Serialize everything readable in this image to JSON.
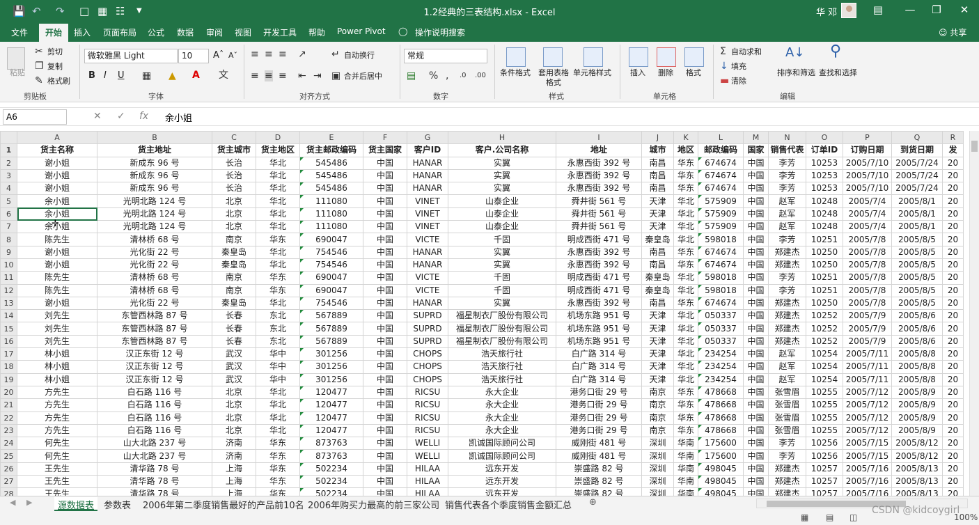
{
  "window": {
    "title": "1.2经典的三表结构.xlsx  -  Excel",
    "user": "华 邓",
    "save_icon": "save-icon",
    "undo_icon": "undo-icon",
    "redo_icon": "redo-icon"
  },
  "ribbon_tabs": [
    "文件",
    "开始",
    "插入",
    "页面布局",
    "公式",
    "数据",
    "审阅",
    "视图",
    "开发工具",
    "帮助",
    "Power Pivot",
    "操作说明搜索",
    "共享"
  ],
  "ribbon": {
    "clipboard": {
      "paste": "粘贴",
      "cut": "剪切",
      "copy": "复制",
      "format_painter": "格式刷",
      "group": "剪贴板"
    },
    "font": {
      "name": "微软雅黑 Light",
      "size": "10",
      "bold": "B",
      "italic": "I",
      "underline": "U",
      "group": "字体"
    },
    "alignment": {
      "wrap": "自动换行",
      "merge": "合并后居中",
      "group": "对齐方式"
    },
    "number": {
      "format": "常规",
      "group": "数字"
    },
    "styles": {
      "conditional": "条件格式",
      "table": "套用表格格式",
      "cell_styles": "单元格样式",
      "group": "样式"
    },
    "cells": {
      "insert": "插入",
      "delete": "删除",
      "format": "格式",
      "group": "单元格"
    },
    "editing": {
      "autosum": "自动求和",
      "fill": "填充",
      "clear": "清除",
      "sort": "排序和筛选",
      "find": "查找和选择",
      "group": "编辑"
    }
  },
  "formula_bar": {
    "name_box": "A6",
    "fx": "fx",
    "value": "余小姐"
  },
  "columns": [
    "A",
    "B",
    "C",
    "D",
    "E",
    "F",
    "G",
    "H",
    "I",
    "J",
    "K",
    "L",
    "M",
    "N",
    "O",
    "P",
    "Q",
    "R"
  ],
  "header_row": [
    "货主名称",
    "货主地址",
    "货主城市",
    "货主地区",
    "货主邮政编码",
    "货主国家",
    "客户ID",
    "客户.公司名称",
    "地址",
    "城市",
    "地区",
    "邮政编码",
    "国家",
    "销售代表",
    "订单ID",
    "订购日期",
    "到货日期",
    "发"
  ],
  "rows": [
    [
      "谢小姐",
      "新成东 96 号",
      "长治",
      "华北",
      "545486",
      "中国",
      "HANAR",
      "实翼",
      "永惠西街 392 号",
      "南昌",
      "华东",
      "674674",
      "中国",
      "李芳",
      "10253",
      "2005/7/10",
      "2005/7/24",
      "20"
    ],
    [
      "谢小姐",
      "新成东 96 号",
      "长治",
      "华北",
      "545486",
      "中国",
      "HANAR",
      "实翼",
      "永惠西街 392 号",
      "南昌",
      "华东",
      "674674",
      "中国",
      "李芳",
      "10253",
      "2005/7/10",
      "2005/7/24",
      "20"
    ],
    [
      "谢小姐",
      "新成东 96 号",
      "长治",
      "华北",
      "545486",
      "中国",
      "HANAR",
      "实翼",
      "永惠西街 392 号",
      "南昌",
      "华东",
      "674674",
      "中国",
      "李芳",
      "10253",
      "2005/7/10",
      "2005/7/24",
      "20"
    ],
    [
      "余小姐",
      "光明北路 124 号",
      "北京",
      "华北",
      "111080",
      "中国",
      "VINET",
      "山泰企业",
      "舜井街 561 号",
      "天津",
      "华北",
      "575909",
      "中国",
      "赵军",
      "10248",
      "2005/7/4",
      "2005/8/1",
      "20"
    ],
    [
      "余小姐",
      "光明北路 124 号",
      "北京",
      "华北",
      "111080",
      "中国",
      "VINET",
      "山泰企业",
      "舜井街 561 号",
      "天津",
      "华北",
      "575909",
      "中国",
      "赵军",
      "10248",
      "2005/7/4",
      "2005/8/1",
      "20"
    ],
    [
      "余小姐",
      "光明北路 124 号",
      "北京",
      "华北",
      "111080",
      "中国",
      "VINET",
      "山泰企业",
      "舜井街 561 号",
      "天津",
      "华北",
      "575909",
      "中国",
      "赵军",
      "10248",
      "2005/7/4",
      "2005/8/1",
      "20"
    ],
    [
      "陈先生",
      "清林桥 68 号",
      "南京",
      "华东",
      "690047",
      "中国",
      "VICTE",
      "千固",
      "明成西街 471 号",
      "秦皇岛",
      "华北",
      "598018",
      "中国",
      "李芳",
      "10251",
      "2005/7/8",
      "2005/8/5",
      "20"
    ],
    [
      "谢小姐",
      "光化街 22 号",
      "秦皇岛",
      "华北",
      "754546",
      "中国",
      "HANAR",
      "实翼",
      "永惠西街 392 号",
      "南昌",
      "华东",
      "674674",
      "中国",
      "郑建杰",
      "10250",
      "2005/7/8",
      "2005/8/5",
      "20"
    ],
    [
      "谢小姐",
      "光化街 22 号",
      "秦皇岛",
      "华北",
      "754546",
      "中国",
      "HANAR",
      "实翼",
      "永惠西街 392 号",
      "南昌",
      "华东",
      "674674",
      "中国",
      "郑建杰",
      "10250",
      "2005/7/8",
      "2005/8/5",
      "20"
    ],
    [
      "陈先生",
      "清林桥 68 号",
      "南京",
      "华东",
      "690047",
      "中国",
      "VICTE",
      "千固",
      "明成西街 471 号",
      "秦皇岛",
      "华北",
      "598018",
      "中国",
      "李芳",
      "10251",
      "2005/7/8",
      "2005/8/5",
      "20"
    ],
    [
      "陈先生",
      "清林桥 68 号",
      "南京",
      "华东",
      "690047",
      "中国",
      "VICTE",
      "千固",
      "明成西街 471 号",
      "秦皇岛",
      "华北",
      "598018",
      "中国",
      "李芳",
      "10251",
      "2005/7/8",
      "2005/8/5",
      "20"
    ],
    [
      "谢小姐",
      "光化街 22 号",
      "秦皇岛",
      "华北",
      "754546",
      "中国",
      "HANAR",
      "实翼",
      "永惠西街 392 号",
      "南昌",
      "华东",
      "674674",
      "中国",
      "郑建杰",
      "10250",
      "2005/7/8",
      "2005/8/5",
      "20"
    ],
    [
      "刘先生",
      "东管西林路 87 号",
      "长春",
      "东北",
      "567889",
      "中国",
      "SUPRD",
      "福星制衣厂股份有限公司",
      "机场东路 951 号",
      "天津",
      "华北",
      "050337",
      "中国",
      "郑建杰",
      "10252",
      "2005/7/9",
      "2005/8/6",
      "20"
    ],
    [
      "刘先生",
      "东管西林路 87 号",
      "长春",
      "东北",
      "567889",
      "中国",
      "SUPRD",
      "福星制衣厂股份有限公司",
      "机场东路 951 号",
      "天津",
      "华北",
      "050337",
      "中国",
      "郑建杰",
      "10252",
      "2005/7/9",
      "2005/8/6",
      "20"
    ],
    [
      "刘先生",
      "东管西林路 87 号",
      "长春",
      "东北",
      "567889",
      "中国",
      "SUPRD",
      "福星制衣厂股份有限公司",
      "机场东路 951 号",
      "天津",
      "华北",
      "050337",
      "中国",
      "郑建杰",
      "10252",
      "2005/7/9",
      "2005/8/6",
      "20"
    ],
    [
      "林小姐",
      "汉正东街 12 号",
      "武汉",
      "华中",
      "301256",
      "中国",
      "CHOPS",
      "浩天旅行社",
      "白广路 314 号",
      "天津",
      "华北",
      "234254",
      "中国",
      "赵军",
      "10254",
      "2005/7/11",
      "2005/8/8",
      "20"
    ],
    [
      "林小姐",
      "汉正东街 12 号",
      "武汉",
      "华中",
      "301256",
      "中国",
      "CHOPS",
      "浩天旅行社",
      "白广路 314 号",
      "天津",
      "华北",
      "234254",
      "中国",
      "赵军",
      "10254",
      "2005/7/11",
      "2005/8/8",
      "20"
    ],
    [
      "林小姐",
      "汉正东街 12 号",
      "武汉",
      "华中",
      "301256",
      "中国",
      "CHOPS",
      "浩天旅行社",
      "白广路 314 号",
      "天津",
      "华北",
      "234254",
      "中国",
      "赵军",
      "10254",
      "2005/7/11",
      "2005/8/8",
      "20"
    ],
    [
      "方先生",
      "白石路 116 号",
      "北京",
      "华北",
      "120477",
      "中国",
      "RICSU",
      "永大企业",
      "港务口街 29 号",
      "南京",
      "华东",
      "478668",
      "中国",
      "张雪眉",
      "10255",
      "2005/7/12",
      "2005/8/9",
      "20"
    ],
    [
      "方先生",
      "白石路 116 号",
      "北京",
      "华北",
      "120477",
      "中国",
      "RICSU",
      "永大企业",
      "港务口街 29 号",
      "南京",
      "华东",
      "478668",
      "中国",
      "张雪眉",
      "10255",
      "2005/7/12",
      "2005/8/9",
      "20"
    ],
    [
      "方先生",
      "白石路 116 号",
      "北京",
      "华北",
      "120477",
      "中国",
      "RICSU",
      "永大企业",
      "港务口街 29 号",
      "南京",
      "华东",
      "478668",
      "中国",
      "张雪眉",
      "10255",
      "2005/7/12",
      "2005/8/9",
      "20"
    ],
    [
      "方先生",
      "白石路 116 号",
      "北京",
      "华北",
      "120477",
      "中国",
      "RICSU",
      "永大企业",
      "港务口街 29 号",
      "南京",
      "华东",
      "478668",
      "中国",
      "张雪眉",
      "10255",
      "2005/7/12",
      "2005/8/9",
      "20"
    ],
    [
      "何先生",
      "山大北路 237 号",
      "济南",
      "华东",
      "873763",
      "中国",
      "WELLI",
      "凯诚国际顾问公司",
      "威刚街 481 号",
      "深圳",
      "华南",
      "175600",
      "中国",
      "李芳",
      "10256",
      "2005/7/15",
      "2005/8/12",
      "20"
    ],
    [
      "何先生",
      "山大北路 237 号",
      "济南",
      "华东",
      "873763",
      "中国",
      "WELLI",
      "凯诚国际顾问公司",
      "威刚街 481 号",
      "深圳",
      "华南",
      "175600",
      "中国",
      "李芳",
      "10256",
      "2005/7/15",
      "2005/8/12",
      "20"
    ],
    [
      "王先生",
      "清华路 78 号",
      "上海",
      "华东",
      "502234",
      "中国",
      "HILAA",
      "远东开发",
      "崇盛路 82 号",
      "深圳",
      "华南",
      "498045",
      "中国",
      "郑建杰",
      "10257",
      "2005/7/16",
      "2005/8/13",
      "20"
    ],
    [
      "王先生",
      "清华路 78 号",
      "上海",
      "华东",
      "502234",
      "中国",
      "HILAA",
      "远东开发",
      "崇盛路 82 号",
      "深圳",
      "华南",
      "498045",
      "中国",
      "郑建杰",
      "10257",
      "2005/7/16",
      "2005/8/13",
      "20"
    ],
    [
      "王先生",
      "清华路 78 号",
      "上海",
      "华东",
      "502234",
      "中国",
      "HILAA",
      "远东开发",
      "崇盛路 82 号",
      "深圳",
      "华南",
      "498045",
      "中国",
      "郑建杰",
      "10257",
      "2005/7/16",
      "2005/8/13",
      "20"
    ]
  ],
  "selected_cell": {
    "row": 6,
    "col": "A"
  },
  "sheet_tabs": [
    "源数据表",
    "参数表",
    "2006年第二季度销售最好的产品前10名",
    "2006年购买力最高的前三家公司",
    "销售代表各个季度销售金额汇总"
  ],
  "active_sheet": 0,
  "status": {
    "zoom": "100%"
  },
  "watermark": "CSDN @kidcoygirl",
  "colors": {
    "accent": "#217346",
    "selection": "#217346",
    "header_bg": "#e9e9e9"
  }
}
